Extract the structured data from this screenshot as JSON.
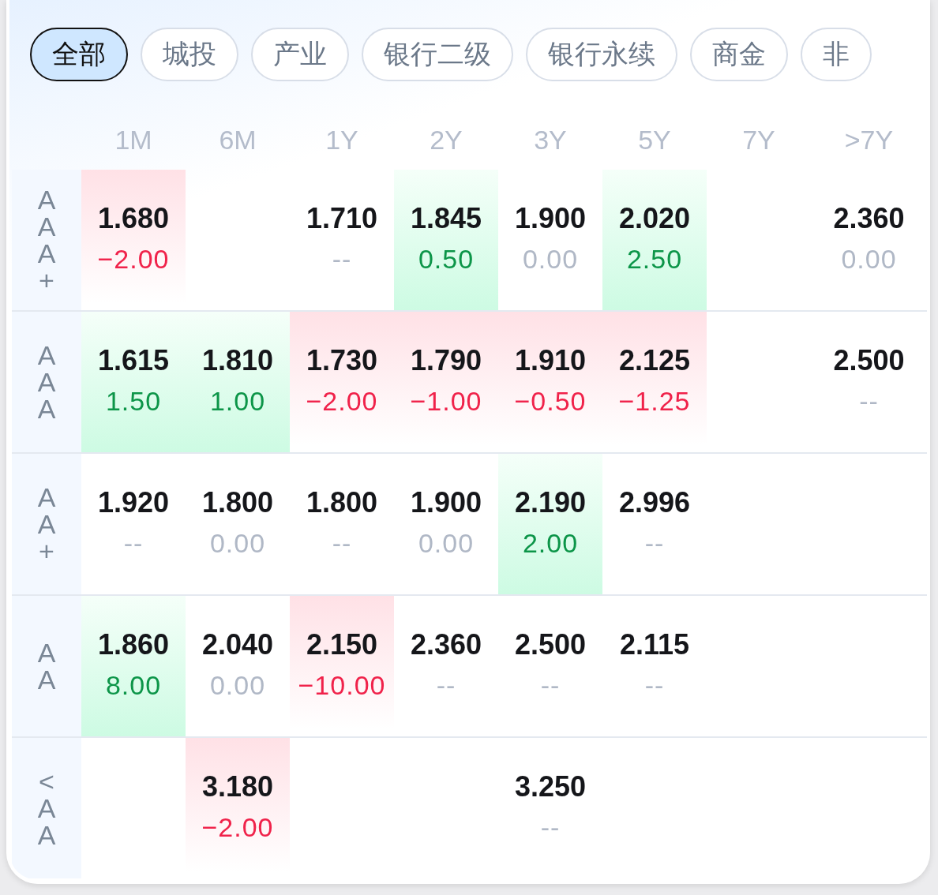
{
  "tabs": [
    {
      "label": "全部",
      "selected": true
    },
    {
      "label": "城投",
      "selected": false
    },
    {
      "label": "产业",
      "selected": false
    },
    {
      "label": "银行二级",
      "selected": false
    },
    {
      "label": "银行永续",
      "selected": false
    },
    {
      "label": "商金",
      "selected": false
    },
    {
      "label": "非",
      "selected": false
    }
  ],
  "columns": [
    "1M",
    "6M",
    "1Y",
    "2Y",
    "3Y",
    "5Y",
    "7Y",
    ">7Y"
  ],
  "rows": [
    {
      "rating": "AAA+",
      "cells": [
        {
          "rate": "1.680",
          "change": "−2.00",
          "kind": "fall"
        },
        null,
        {
          "rate": "1.710",
          "change": "--",
          "kind": "flat"
        },
        {
          "rate": "1.845",
          "change": "0.50",
          "kind": "rise"
        },
        {
          "rate": "1.900",
          "change": "0.00",
          "kind": "flat"
        },
        {
          "rate": "2.020",
          "change": "2.50",
          "kind": "rise"
        },
        null,
        {
          "rate": "2.360",
          "change": "0.00",
          "kind": "flat"
        }
      ]
    },
    {
      "rating": "AAA",
      "cells": [
        {
          "rate": "1.615",
          "change": "1.50",
          "kind": "rise"
        },
        {
          "rate": "1.810",
          "change": "1.00",
          "kind": "rise"
        },
        {
          "rate": "1.730",
          "change": "−2.00",
          "kind": "fall"
        },
        {
          "rate": "1.790",
          "change": "−1.00",
          "kind": "fall"
        },
        {
          "rate": "1.910",
          "change": "−0.50",
          "kind": "fall"
        },
        {
          "rate": "2.125",
          "change": "−1.25",
          "kind": "fall"
        },
        null,
        {
          "rate": "2.500",
          "change": "--",
          "kind": "flat"
        }
      ]
    },
    {
      "rating": "AA+",
      "cells": [
        {
          "rate": "1.920",
          "change": "--",
          "kind": "flat"
        },
        {
          "rate": "1.800",
          "change": "0.00",
          "kind": "flat"
        },
        {
          "rate": "1.800",
          "change": "--",
          "kind": "flat"
        },
        {
          "rate": "1.900",
          "change": "0.00",
          "kind": "flat"
        },
        {
          "rate": "2.190",
          "change": "2.00",
          "kind": "rise"
        },
        {
          "rate": "2.996",
          "change": "--",
          "kind": "flat"
        },
        null,
        null
      ]
    },
    {
      "rating": "AA",
      "cells": [
        {
          "rate": "1.860",
          "change": "8.00",
          "kind": "rise"
        },
        {
          "rate": "2.040",
          "change": "0.00",
          "kind": "flat"
        },
        {
          "rate": "2.150",
          "change": "−10.00",
          "kind": "fall"
        },
        {
          "rate": "2.360",
          "change": "--",
          "kind": "flat"
        },
        {
          "rate": "2.500",
          "change": "--",
          "kind": "flat"
        },
        {
          "rate": "2.115",
          "change": "--",
          "kind": "flat"
        },
        null,
        null
      ]
    },
    {
      "rating": "<AA",
      "cells": [
        null,
        {
          "rate": "3.180",
          "change": "−2.00",
          "kind": "fall"
        },
        null,
        null,
        {
          "rate": "3.250",
          "change": "--",
          "kind": "flat"
        },
        null,
        null,
        null
      ]
    }
  ]
}
